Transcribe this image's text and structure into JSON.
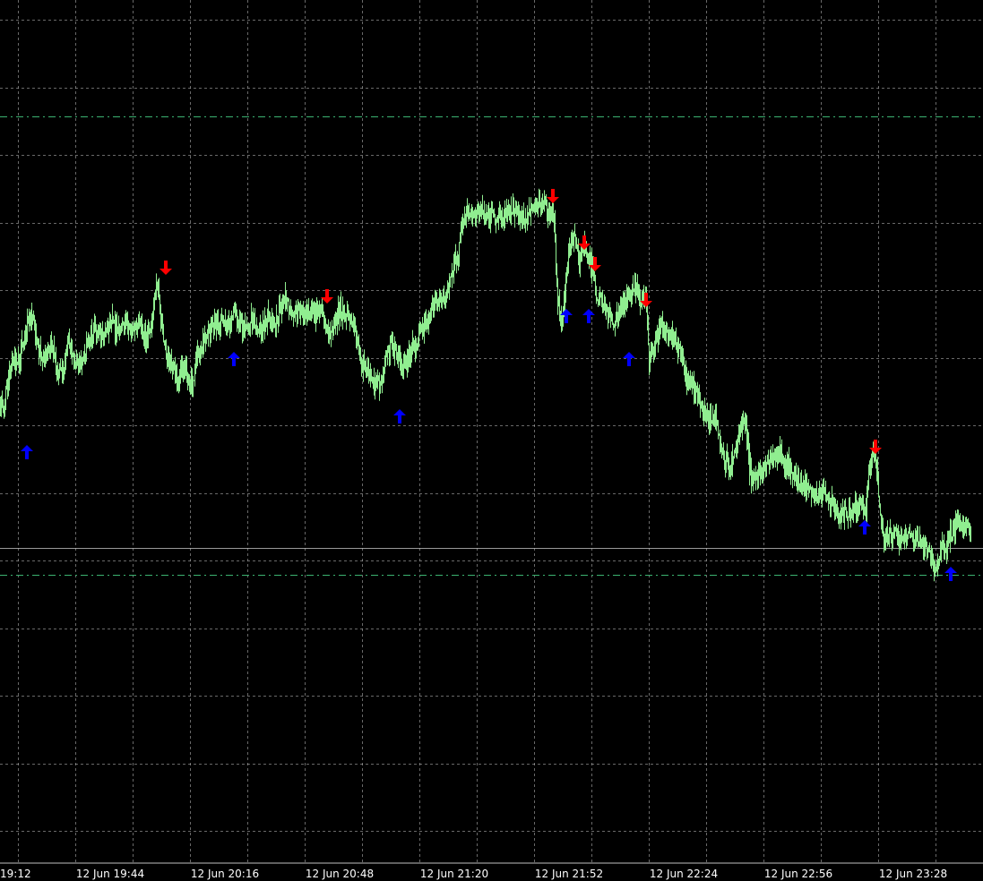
{
  "chart_data": {
    "type": "bar",
    "subtype": "ohlc-bar",
    "x_ticks": [
      "19:12",
      "12 Jun 19:44",
      "12 Jun 20:16",
      "12 Jun 20:48",
      "12 Jun 21:20",
      "12 Jun 21:52",
      "12 Jun 22:24",
      "12 Jun 22:56",
      "12 Jun 23:28"
    ],
    "grid": true,
    "colors": {
      "background": "#000000",
      "bars": "#90ee90",
      "grid": "#c0c0c0",
      "level_lines": "#3cb371",
      "current_price_line": "#c0c0c0",
      "buy_arrow": "#0000ff",
      "sell_arrow": "#ff0000",
      "axis_text": "#ffffff"
    },
    "price_path": [
      [
        0,
        50
      ],
      [
        4,
        52
      ],
      [
        8,
        43
      ],
      [
        14,
        39
      ],
      [
        22,
        37
      ],
      [
        30,
        28
      ],
      [
        36,
        26
      ],
      [
        42,
        34
      ],
      [
        48,
        38
      ],
      [
        56,
        33
      ],
      [
        64,
        41
      ],
      [
        70,
        42
      ],
      [
        76,
        33
      ],
      [
        84,
        39
      ],
      [
        92,
        38
      ],
      [
        100,
        32
      ],
      [
        108,
        29
      ],
      [
        116,
        32
      ],
      [
        124,
        27
      ],
      [
        132,
        31
      ],
      [
        140,
        28
      ],
      [
        148,
        29
      ],
      [
        156,
        28
      ],
      [
        164,
        33
      ],
      [
        170,
        26
      ],
      [
        174,
        15
      ],
      [
        178,
        23
      ],
      [
        182,
        32
      ],
      [
        186,
        36
      ],
      [
        192,
        40
      ],
      [
        198,
        46
      ],
      [
        202,
        39
      ],
      [
        208,
        42
      ],
      [
        214,
        45
      ],
      [
        220,
        36
      ],
      [
        226,
        34
      ],
      [
        232,
        30
      ],
      [
        238,
        28
      ],
      [
        244,
        28
      ],
      [
        250,
        27
      ],
      [
        256,
        29
      ],
      [
        262,
        24
      ],
      [
        268,
        27
      ],
      [
        274,
        30
      ],
      [
        280,
        27
      ],
      [
        290,
        30
      ],
      [
        298,
        26
      ],
      [
        306,
        29
      ],
      [
        312,
        24
      ],
      [
        318,
        20
      ],
      [
        324,
        24
      ],
      [
        330,
        25
      ],
      [
        336,
        23
      ],
      [
        342,
        25
      ],
      [
        350,
        26
      ],
      [
        358,
        24
      ],
      [
        366,
        31
      ],
      [
        372,
        28
      ],
      [
        378,
        24
      ],
      [
        386,
        26
      ],
      [
        394,
        27
      ],
      [
        402,
        38
      ],
      [
        410,
        42
      ],
      [
        418,
        44
      ],
      [
        424,
        45
      ],
      [
        430,
        38
      ],
      [
        436,
        34
      ],
      [
        442,
        36
      ],
      [
        448,
        39
      ],
      [
        454,
        38
      ],
      [
        460,
        35
      ],
      [
        466,
        32
      ],
      [
        472,
        29
      ],
      [
        478,
        27
      ],
      [
        484,
        23
      ],
      [
        490,
        22
      ],
      [
        496,
        20
      ],
      [
        502,
        16
      ],
      [
        508,
        11
      ],
      [
        512,
        6
      ],
      [
        516,
        0
      ],
      [
        520,
        -3
      ],
      [
        526,
        -2
      ],
      [
        534,
        -4
      ],
      [
        542,
        -2
      ],
      [
        550,
        -3
      ],
      [
        558,
        -1
      ],
      [
        566,
        -3
      ],
      [
        574,
        -4
      ],
      [
        582,
        -2
      ],
      [
        590,
        -3
      ],
      [
        598,
        -4
      ],
      [
        604,
        -6
      ],
      [
        612,
        -4
      ],
      [
        618,
        -2
      ],
      [
        622,
        22
      ],
      [
        626,
        28
      ],
      [
        630,
        20
      ],
      [
        634,
        8
      ],
      [
        638,
        5
      ],
      [
        642,
        3
      ],
      [
        646,
        11
      ],
      [
        650,
        6
      ],
      [
        654,
        9
      ],
      [
        660,
        12
      ],
      [
        666,
        21
      ],
      [
        672,
        22
      ],
      [
        678,
        24
      ],
      [
        684,
        28
      ],
      [
        690,
        24
      ],
      [
        696,
        23
      ],
      [
        702,
        19
      ],
      [
        708,
        17
      ],
      [
        714,
        22
      ],
      [
        720,
        20
      ],
      [
        724,
        39
      ],
      [
        730,
        34
      ],
      [
        736,
        28
      ],
      [
        742,
        30
      ],
      [
        748,
        31
      ],
      [
        754,
        33
      ],
      [
        760,
        36
      ],
      [
        766,
        44
      ],
      [
        772,
        44
      ],
      [
        778,
        48
      ],
      [
        784,
        52
      ],
      [
        790,
        55
      ],
      [
        796,
        53
      ],
      [
        802,
        60
      ],
      [
        808,
        66
      ],
      [
        814,
        67
      ],
      [
        820,
        64
      ],
      [
        826,
        58
      ],
      [
        832,
        56
      ],
      [
        836,
        68
      ],
      [
        840,
        72
      ],
      [
        846,
        71
      ],
      [
        852,
        68
      ],
      [
        858,
        66
      ],
      [
        864,
        65
      ],
      [
        870,
        63
      ],
      [
        876,
        67
      ],
      [
        882,
        68
      ],
      [
        888,
        72
      ],
      [
        894,
        74
      ],
      [
        900,
        73
      ],
      [
        906,
        74
      ],
      [
        912,
        76
      ],
      [
        918,
        75
      ],
      [
        924,
        78
      ],
      [
        930,
        79
      ],
      [
        936,
        82
      ],
      [
        942,
        80
      ],
      [
        948,
        81
      ],
      [
        954,
        79
      ],
      [
        960,
        78
      ],
      [
        966,
        80
      ],
      [
        970,
        68
      ],
      [
        974,
        62
      ],
      [
        978,
        67
      ],
      [
        982,
        82
      ],
      [
        986,
        88
      ],
      [
        992,
        87
      ],
      [
        998,
        87
      ],
      [
        1004,
        89
      ],
      [
        1010,
        88
      ],
      [
        1016,
        88
      ],
      [
        1022,
        89
      ],
      [
        1028,
        89
      ],
      [
        1034,
        91
      ],
      [
        1040,
        94
      ],
      [
        1044,
        96
      ],
      [
        1050,
        91
      ],
      [
        1056,
        90
      ],
      [
        1062,
        86
      ],
      [
        1068,
        84
      ],
      [
        1074,
        84
      ],
      [
        1080,
        86
      ],
      [
        1083,
        87
      ]
    ],
    "buy_signals": [
      {
        "index": 30,
        "y": 64
      },
      {
        "index": 261,
        "y": 38
      },
      {
        "index": 446,
        "y": 54
      },
      {
        "index": 632,
        "y": 26
      },
      {
        "index": 657,
        "y": 26
      },
      {
        "index": 702,
        "y": 38
      },
      {
        "index": 965,
        "y": 85
      },
      {
        "index": 1061,
        "y": 98
      }
    ],
    "sell_signals": [
      {
        "index": 185,
        "y": 12
      },
      {
        "index": 365,
        "y": 20
      },
      {
        "index": 617,
        "y": -8
      },
      {
        "index": 652,
        "y": 5
      },
      {
        "index": 664,
        "y": 11
      },
      {
        "index": 721,
        "y": 21
      },
      {
        "index": 977,
        "y": 62
      }
    ],
    "level_lines": [
      -30,
      98
    ],
    "current_price": 90.5
  }
}
